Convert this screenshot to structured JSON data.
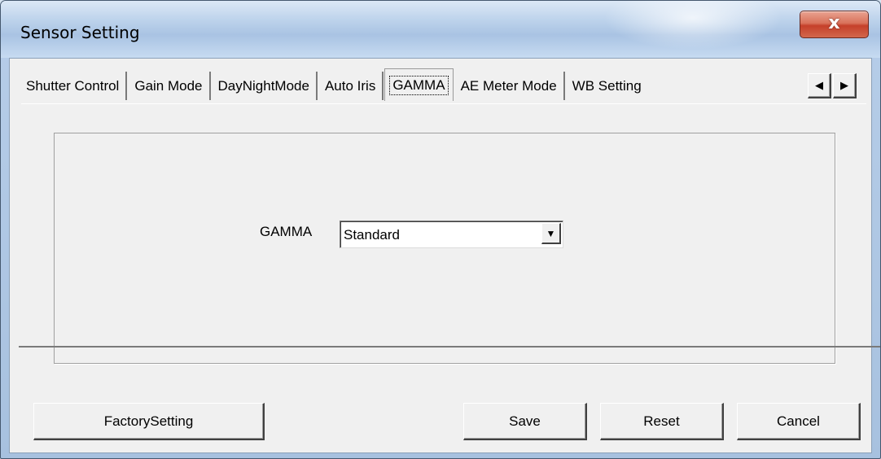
{
  "window": {
    "title": "Sensor Setting",
    "close_glyph": "x"
  },
  "tabs": [
    {
      "label": "Shutter Control",
      "active": false
    },
    {
      "label": "Gain Mode",
      "active": false
    },
    {
      "label": "DayNightMode",
      "active": false
    },
    {
      "label": "Auto Iris",
      "active": false
    },
    {
      "label": "GAMMA",
      "active": true
    },
    {
      "label": "AE Meter Mode",
      "active": false
    },
    {
      "label": "WB Setting",
      "active": false
    }
  ],
  "tab_scroll": {
    "left_glyph": "◀",
    "right_glyph": "▶"
  },
  "gamma": {
    "label": "GAMMA",
    "value": "Standard",
    "dropdown_glyph": "▼"
  },
  "buttons": {
    "factory": "FactorySetting",
    "save": "Save",
    "reset": "Reset",
    "cancel": "Cancel"
  }
}
